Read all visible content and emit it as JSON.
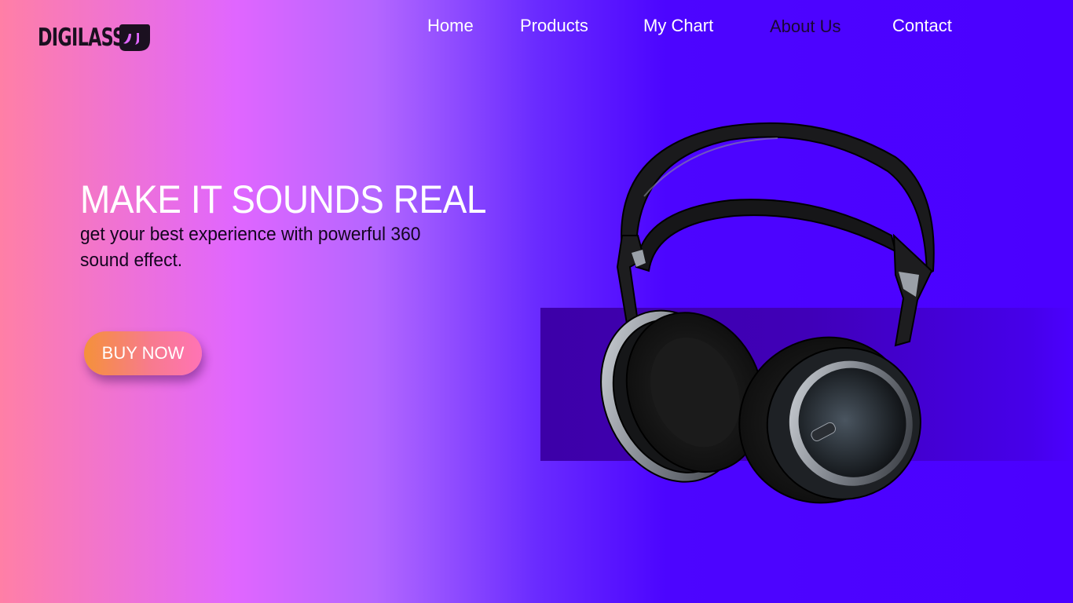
{
  "brand": {
    "name": "DIGILASS",
    "logo_icon": "headphone-mark-icon"
  },
  "nav": {
    "items": [
      {
        "label": "Home"
      },
      {
        "label": "Products"
      },
      {
        "label": "My Chart"
      },
      {
        "label": "About Us"
      },
      {
        "label": "Contact"
      }
    ]
  },
  "hero": {
    "headline": "MAKE IT SOUNDS REAL",
    "subtext": "get your best experience with powerful 360 sound effect.",
    "cta_label": "BUY NOW",
    "product_image": "headphones-image"
  },
  "colors": {
    "gradient_left": "#ff7fa6",
    "gradient_mid": "#e066ff",
    "gradient_right": "#4b00ff",
    "band": "#3d00a8",
    "button_start": "#f5913a",
    "button_end": "#ff73b5",
    "dark_text": "#14051f",
    "light_text": "#ffffff"
  }
}
